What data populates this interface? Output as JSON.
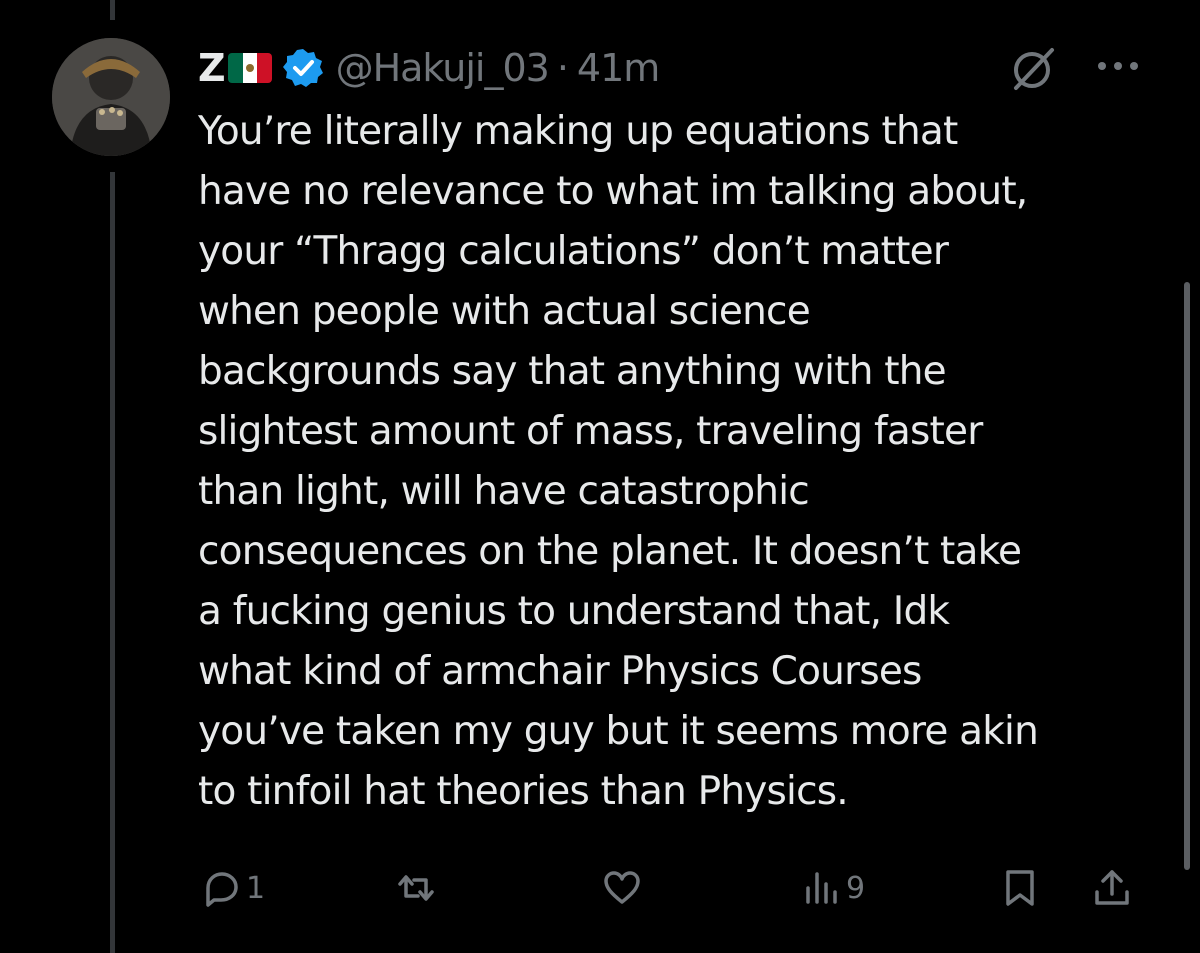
{
  "tweet": {
    "author": {
      "display_name": "Z",
      "flag_emoji": "mexico-flag",
      "verified": true,
      "handle": "@Hakuji_03",
      "separator": "·",
      "time": "41m"
    },
    "text": "You’re literally making up equations that\nhave no relevance to what im talking about,\nyour “Thragg calculations” don’t matter\nwhen people with actual science\nbackgrounds say that anything with the\nslightest amount of mass, traveling faster\nthan light, will have catastrophic\nconsequences on the planet. It doesn’t take\na fucking genius to understand that, Idk\nwhat kind of armchair Physics Courses\nyou’ve taken my guy but it seems more akin\nto tinfoil hat theories than Physics.",
    "actions": {
      "reply_count": "1",
      "repost_count": "",
      "like_count": "",
      "views_count": "9"
    }
  },
  "colors": {
    "background": "#000000",
    "text_primary": "#e7e9ea",
    "text_secondary": "#71767b",
    "verified_badge": "#1d9bf0",
    "thread_line": "#333639"
  },
  "icons": {
    "grok": "grok-slash-icon",
    "more": "more-options-icon",
    "reply": "reply-icon",
    "repost": "repost-icon",
    "like": "heart-icon",
    "views": "views-chart-icon",
    "bookmark": "bookmark-icon",
    "share": "share-icon"
  }
}
